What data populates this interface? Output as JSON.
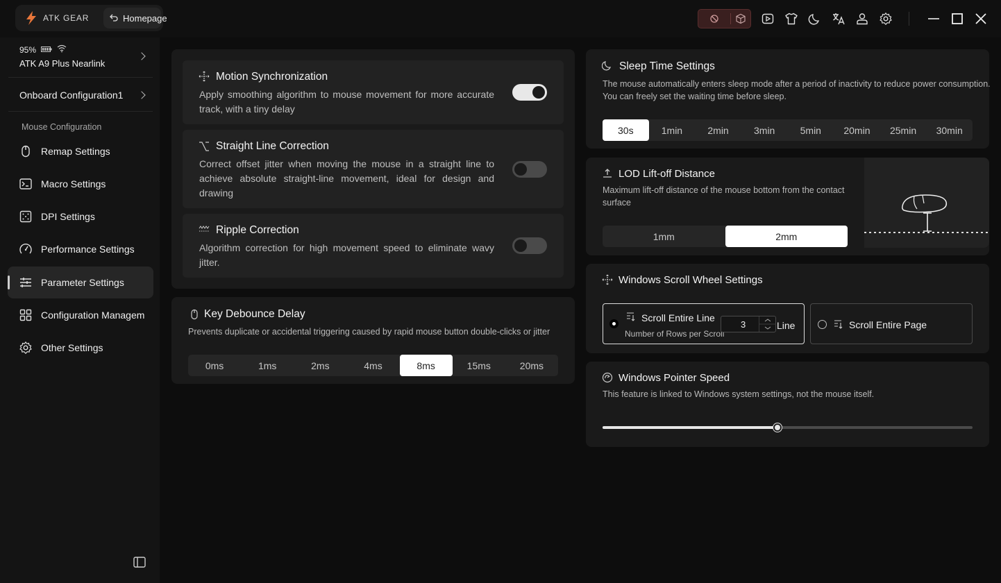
{
  "app": {
    "brand": "ATK GEAR",
    "home_label": "Homepage"
  },
  "device": {
    "battery": "95%",
    "name": "ATK A9 Plus Nearlink"
  },
  "onboard": {
    "label": "Onboard Configuration1"
  },
  "sidebar": {
    "section_label": "Mouse Configuration",
    "items": [
      {
        "label": "Remap Settings",
        "icon": "mouse-icon"
      },
      {
        "label": "Macro Settings",
        "icon": "terminal-icon"
      },
      {
        "label": "DPI Settings",
        "icon": "dice-icon"
      },
      {
        "label": "Performance Settings",
        "icon": "gauge-icon"
      },
      {
        "label": "Parameter Settings",
        "icon": "sliders-icon",
        "active": true
      },
      {
        "label": "Configuration Managem",
        "icon": "grid-icon"
      },
      {
        "label": "Other Settings",
        "icon": "gear-icon"
      }
    ]
  },
  "motion": {
    "title": "Motion Synchronization",
    "desc": "Apply smoothing algorithm to mouse movement for more accurate track, with a tiny delay",
    "enabled": true
  },
  "straight": {
    "title": "Straight Line Correction",
    "desc": "Correct offset jitter when moving the mouse in a straight line to achieve absolute straight-line movement, ideal for design and drawing",
    "enabled": false
  },
  "ripple": {
    "title": "Ripple Correction",
    "desc": "Algorithm correction for high movement speed to eliminate wavy jitter.",
    "enabled": false
  },
  "debounce": {
    "title": "Key Debounce Delay",
    "desc": "Prevents duplicate or accidental triggering caused by rapid mouse button double-clicks or jitter",
    "options": [
      "0ms",
      "1ms",
      "2ms",
      "4ms",
      "8ms",
      "15ms",
      "20ms"
    ],
    "selected": "8ms"
  },
  "sleep": {
    "title": "Sleep Time Settings",
    "desc_line1": "The mouse automatically enters sleep mode after a period of inactivity to reduce power consumption.",
    "desc_line2": "You can freely set the waiting time before sleep.",
    "options": [
      "30s",
      "1min",
      "2min",
      "3min",
      "5min",
      "20min",
      "25min",
      "30min"
    ],
    "selected": "30s"
  },
  "lod": {
    "title": "LOD Lift-off Distance",
    "desc_line1": "Maximum lift-off distance of the mouse bottom from the contact",
    "desc_line2": "surface",
    "options": [
      "1mm",
      "2mm"
    ],
    "selected": "2mm"
  },
  "scroll": {
    "title": "Windows Scroll Wheel Settings",
    "line_label": "Scroll Entire Line",
    "rows_label": "Number of Rows per Scroll",
    "rows_value": "3",
    "unit": "Line",
    "page_label": "Scroll Entire Page",
    "selected": "line"
  },
  "pointer": {
    "title": "Windows Pointer Speed",
    "desc": "This feature is linked to Windows system settings, not the mouse itself.",
    "speed_fraction": 0.473
  },
  "colors": {
    "accent_orange": "#e8763a",
    "panel": "#1a1a1a",
    "card": "#222222"
  }
}
